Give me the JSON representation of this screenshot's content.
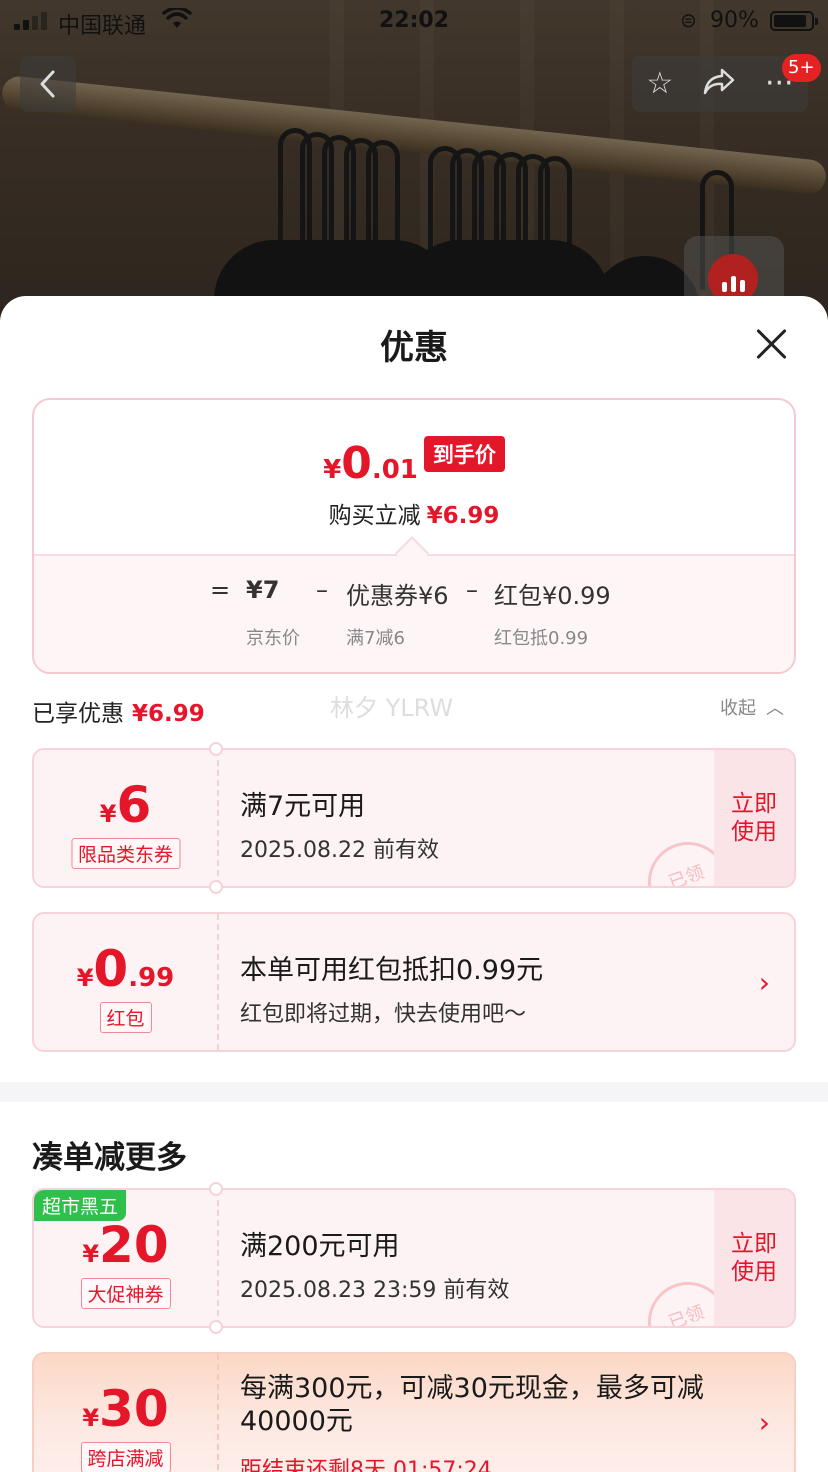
{
  "status_bar": {
    "carrier": "中国联通",
    "time": "22:02",
    "battery": "90%"
  },
  "nav": {
    "message_badge": "5+"
  },
  "sheet": {
    "title": "优惠",
    "summary": {
      "final_price": {
        "yen": "¥",
        "int": "0",
        "dec": ".01"
      },
      "final_tag": "到手价",
      "reduce_label": "购买立减",
      "reduce_value": "¥6.99",
      "breakdown": {
        "equals": "=",
        "jd_price": "¥7",
        "jd_price_label": "京东价",
        "minus1": "–",
        "coupon": "优惠券¥6",
        "coupon_label": "满7减6",
        "minus2": "–",
        "redpacket": "红包¥0.99",
        "redpacket_label": "红包抵0.99"
      }
    },
    "enjoyed": {
      "label": "已享优惠",
      "value": "¥6.99",
      "collapse": "收起"
    },
    "watermark": "林夕 YLRW",
    "coupons": [
      {
        "amount": {
          "yen": "¥",
          "int": "6",
          "dec": ""
        },
        "type": "限品类东券",
        "title": "满7元可用",
        "subtitle": "2025.08.22 前有效",
        "button": "立即\n使用",
        "stamp": "已领"
      },
      {
        "amount": {
          "yen": "¥",
          "int": "0",
          "dec": ".99"
        },
        "type": "红包",
        "title": "本单可用红包抵扣0.99元",
        "subtitle": "红包即将过期，快去使用吧～"
      }
    ],
    "more_section": {
      "title": "凑单减更多",
      "coupons": [
        {
          "tag": "超市黑五",
          "amount": {
            "yen": "¥",
            "int": "20"
          },
          "type": "大促神券",
          "title": "满200元可用",
          "subtitle": "2025.08.23 23:59 前有效",
          "button": "立即\n使用",
          "stamp": "已领"
        },
        {
          "amount": {
            "yen": "¥",
            "int": "30"
          },
          "type": "跨店满减",
          "title": "每满300元，可减30元现金，最多可减40000元",
          "countdown": "距结束还剩8天 01:57:24"
        }
      ]
    }
  },
  "icons": {
    "back": "chevron-left-icon",
    "favorite": "star-icon",
    "share": "share-icon",
    "more": "more-icon",
    "close": "close-icon",
    "collapse": "chevron-up-icon",
    "arrow": "chevron-right-icon"
  },
  "colors": {
    "accent": "#e4162a",
    "tag_green": "#2ec04a",
    "coupon_bg": "#fdf3f4"
  }
}
